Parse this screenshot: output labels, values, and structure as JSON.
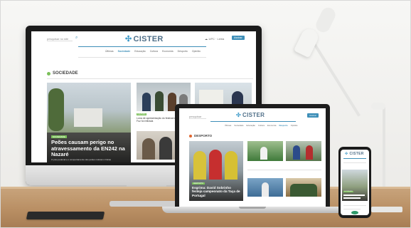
{
  "brand": {
    "name": "CISTER",
    "accent": "#3e8fb8",
    "section_accent": "#7bbf5a"
  },
  "monitor": {
    "search_placeholder": "pesquisar no site",
    "weather": "☁ 14ºC · Leiria",
    "cta": "Assinar",
    "nav": [
      "Últimas",
      "Sociedade",
      "Educação",
      "Cultura",
      "Economia",
      "Desporto",
      "Opinião"
    ],
    "active_nav": "Sociedade",
    "section": "SOCIEDADE",
    "hero": {
      "tag": "SOCIEDADE",
      "title": "Peões causam perigo no atravessamento da EN242 na Nazaré",
      "lede": "O piso pedonal e o comportamento dos peões motivam críticas"
    },
    "side_story": {
      "tag": "CULTURA",
      "title": "Lona de apresentação do festival dos peões de Foz foi retirada"
    }
  },
  "laptop": {
    "search_placeholder": "pesquisar",
    "cta": "Assinar",
    "nav": [
      "Últimas",
      "Sociedade",
      "Educação",
      "Cultura",
      "Economia",
      "Desporto",
      "Opinião"
    ],
    "active_nav": "Desporto",
    "section": "DESPORTO",
    "hero": {
      "tag": "DESPORTO",
      "title": "Esgrima: David Sobrinho festeja campeonato da Taça de Portugal"
    }
  },
  "phone": {
    "tag": "SOCIEDADE"
  }
}
